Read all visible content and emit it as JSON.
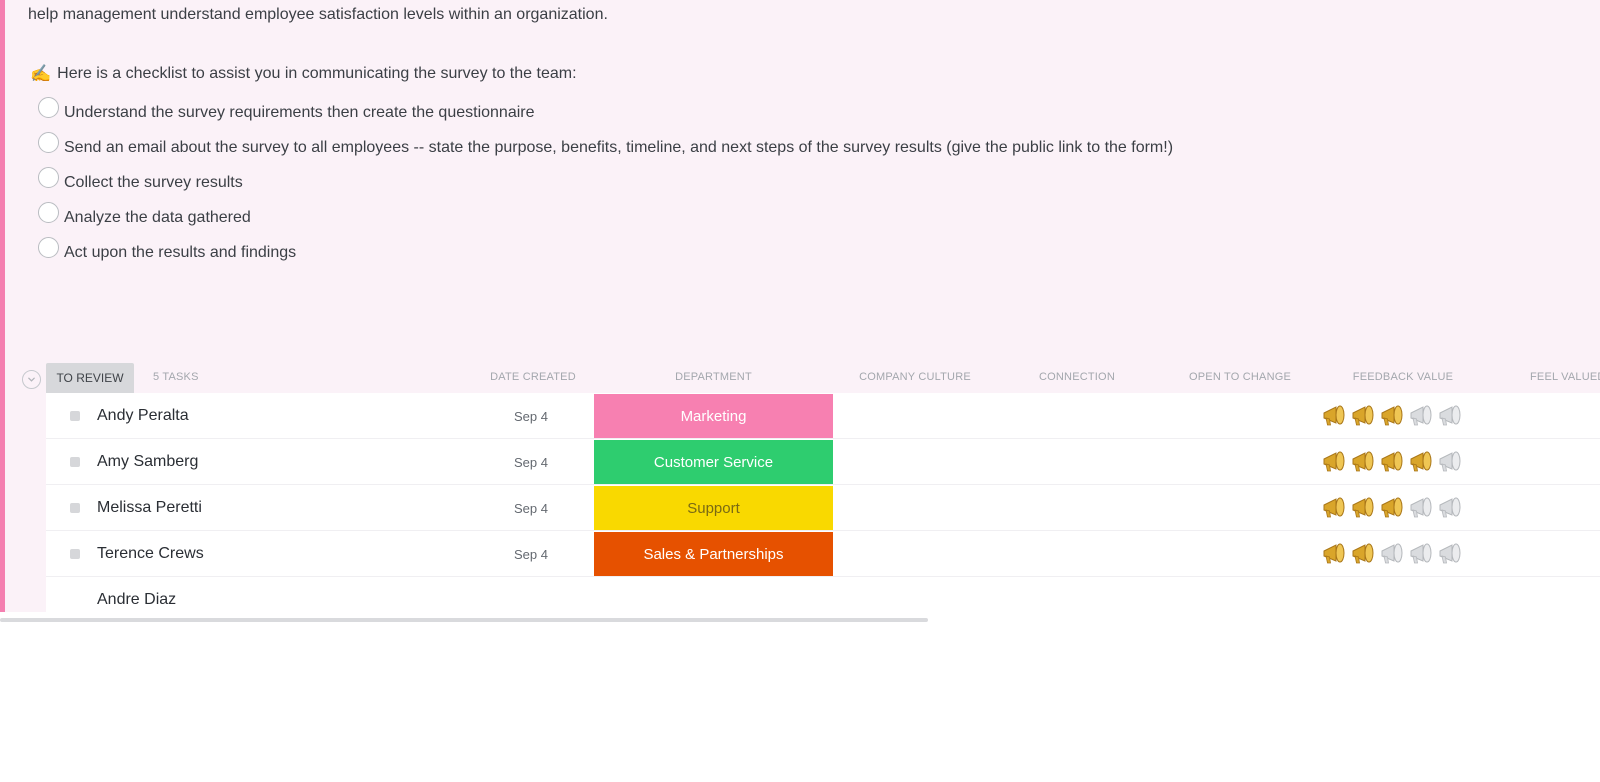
{
  "description": "help management understand employee satisfaction levels within an organization.",
  "checklist_intro": {
    "emoji": "✍️",
    "text": "Here is a checklist to assist you in communicating the survey to the team:"
  },
  "checklist": [
    "Understand the survey requirements then create the questionnaire",
    "Send an email about the survey to all employees -- state the purpose, benefits, timeline, and next steps of the survey results (give the public link to the form!)",
    "Collect the survey results",
    "Analyze the data gathered",
    "Act upon the results and findings"
  ],
  "group": {
    "status": "TO REVIEW",
    "task_count": "5 TASKS",
    "columns": {
      "date_created": "DATE CREATED",
      "department": "DEPARTMENT",
      "company_culture": "COMPANY CULTURE",
      "connection": "CONNECTION",
      "open_to_change": "OPEN TO CHANGE",
      "feedback_value": "FEEDBACK VALUE",
      "feel_valued": "FEEL VALUED"
    }
  },
  "rating_icon": "megaphone-icon",
  "rating_max": 5,
  "tasks": [
    {
      "name": "Andy Peralta",
      "date": "Sep 4",
      "department": "Marketing",
      "dept_color": "#f780b1",
      "dept_text_color": "#ffffff",
      "feedback_value": 3
    },
    {
      "name": "Amy Samberg",
      "date": "Sep 4",
      "department": "Customer Service",
      "dept_color": "#2ecd6f",
      "dept_text_color": "#ffffff",
      "feedback_value": 4
    },
    {
      "name": "Melissa Peretti",
      "date": "Sep 4",
      "department": "Support",
      "dept_color": "#f9d900",
      "dept_text_color": "#7a6a14",
      "feedback_value": 3
    },
    {
      "name": "Terence Crews",
      "date": "Sep 4",
      "department": "Sales & Partnerships",
      "dept_color": "#e65100",
      "dept_text_color": "#ffffff",
      "feedback_value": 2
    },
    {
      "name": "Andre Diaz",
      "date": "",
      "department": "",
      "dept_color": "",
      "dept_text_color": "",
      "feedback_value": 0
    }
  ]
}
